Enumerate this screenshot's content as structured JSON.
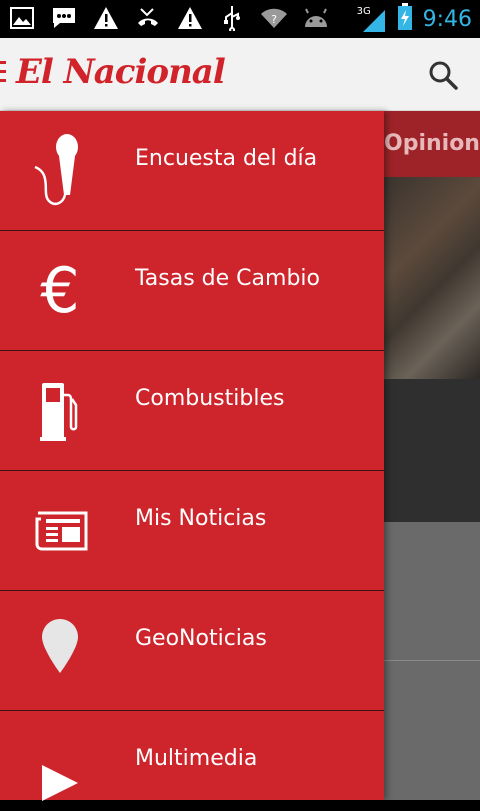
{
  "status_bar": {
    "time": "9:46",
    "network": "3G"
  },
  "app": {
    "logo_text": "El Nacional",
    "brand_color": "#d0232a",
    "drawer_color": "#ce242b"
  },
  "background": {
    "tab_label": "Opinion"
  },
  "drawer": {
    "items": [
      {
        "label": "Encuesta del día",
        "icon": "microphone-icon"
      },
      {
        "label": "Tasas de Cambio",
        "icon": "euro-icon"
      },
      {
        "label": "Combustibles",
        "icon": "fuel-pump-icon"
      },
      {
        "label": "Mis Noticias",
        "icon": "newspaper-icon"
      },
      {
        "label": "GeoNoticias",
        "icon": "map-pin-icon"
      },
      {
        "label": "Multimedia",
        "icon": "play-icon"
      }
    ]
  }
}
